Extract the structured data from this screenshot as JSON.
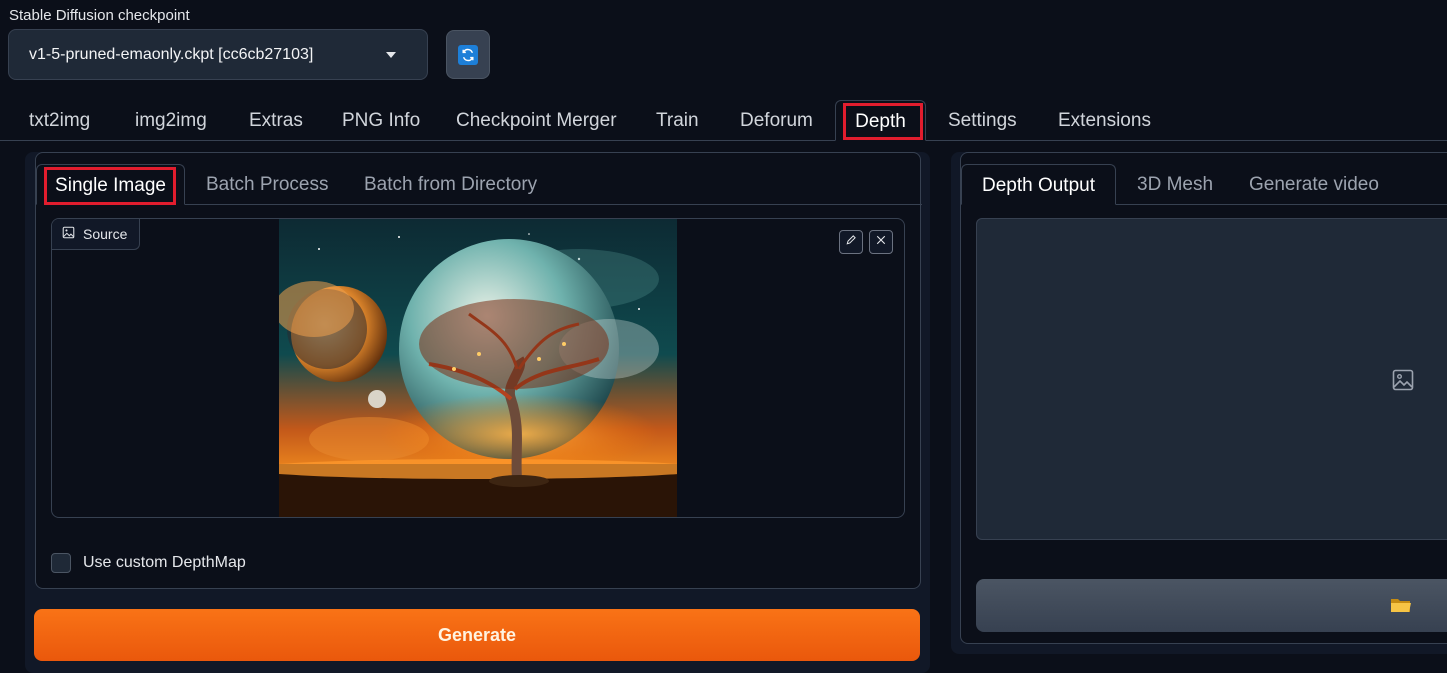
{
  "checkpoint": {
    "label": "Stable Diffusion checkpoint",
    "selected": "v1-5-pruned-emaonly.ckpt [cc6cb27103]"
  },
  "main_tabs": [
    "txt2img",
    "img2img",
    "Extras",
    "PNG Info",
    "Checkpoint Merger",
    "Train",
    "Deforum",
    "Depth",
    "Settings",
    "Extensions"
  ],
  "main_tab_active": "Depth",
  "input_tabs": [
    "Single Image",
    "Batch Process",
    "Batch from Directory"
  ],
  "input_tab_active": "Single Image",
  "source": {
    "label": "Source"
  },
  "custom_depthmap": {
    "label": "Use custom DepthMap",
    "checked": false
  },
  "generate": {
    "label": "Generate"
  },
  "output_tabs": [
    "Depth Output",
    "3D Mesh",
    "Generate video"
  ],
  "output_tab_active": "Depth Output",
  "colors": {
    "background": "#0b0f19",
    "panel": "#111827",
    "accent": "#f97316",
    "highlight": "#e11d2e",
    "refresh_icon": "#1d7fd8"
  },
  "icons": [
    "refresh-icon",
    "image-icon",
    "pencil-icon",
    "close-icon",
    "folder-icon",
    "chevron-down-icon"
  ]
}
